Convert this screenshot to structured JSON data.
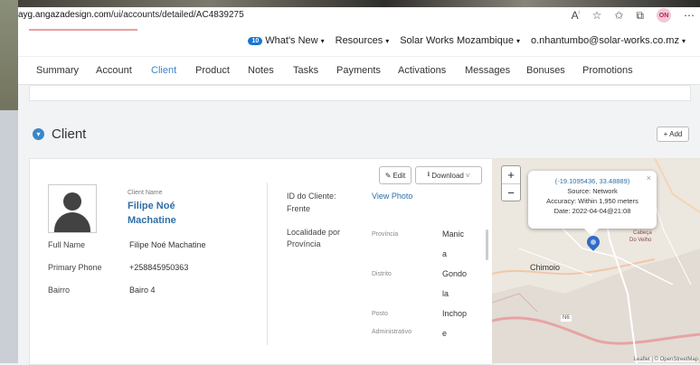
{
  "browser": {
    "url_host": "ayg.angazadesign.com",
    "url_path": "/ui/accounts/detailed/AC4839275",
    "profile_initials": "ON"
  },
  "topnav": {
    "whats_new_count": "10",
    "whats_new": "What's New",
    "resources": "Resources",
    "organization": "Solar Works Mozambique",
    "user_email": "o.nhantumbo@solar-works.co.mz"
  },
  "tabs": [
    "Summary",
    "Account",
    "Client",
    "Product",
    "Notes",
    "Tasks",
    "Payments",
    "Activations",
    "Messages",
    "Bonuses",
    "Promotions"
  ],
  "active_tab": "Client",
  "section": {
    "title": "Client",
    "add_label": "+ Add"
  },
  "card": {
    "edit_label": "Edit",
    "download_label": "Download",
    "client_name_label": "Client Name",
    "client_name_line1": "Filipe Noé",
    "client_name_line2": "Machatine",
    "full_name_label": "Full Name",
    "full_name": "Filipe Noé Machatine",
    "primary_phone_label": "Primary Phone",
    "primary_phone": "+258845950363",
    "bairro_label": "Bairro",
    "bairro": "Bairo 4",
    "id_label_line1": "ID do Cliente:",
    "id_label_line2": "Frente",
    "id_value": "View Photo",
    "localidade_line1": "Localidade por",
    "localidade_line2": "Província",
    "provincia_label": "Província",
    "provincia_value": [
      "Manic",
      "a"
    ],
    "distrito_label": "Distrito",
    "distrito_value": [
      "Gondo",
      "la"
    ],
    "posto_label": "Posto",
    "administrativo_label": "Administrativo",
    "posto_value": [
      "Inchop",
      "e"
    ]
  },
  "map": {
    "coords": "(-19.1095436, 33.48889)",
    "source": "Source: Network",
    "accuracy": "Accuracy: Within 1,950 meters",
    "date": "Date: 2022-04-04@21:08",
    "city": "Chimoio",
    "place_small_1": "Cabeça",
    "place_small_2": "Do Velho",
    "road": "N6",
    "attribution": "Leaflet | © OpenStreetMap",
    "zoom_in": "+",
    "zoom_out": "−"
  }
}
